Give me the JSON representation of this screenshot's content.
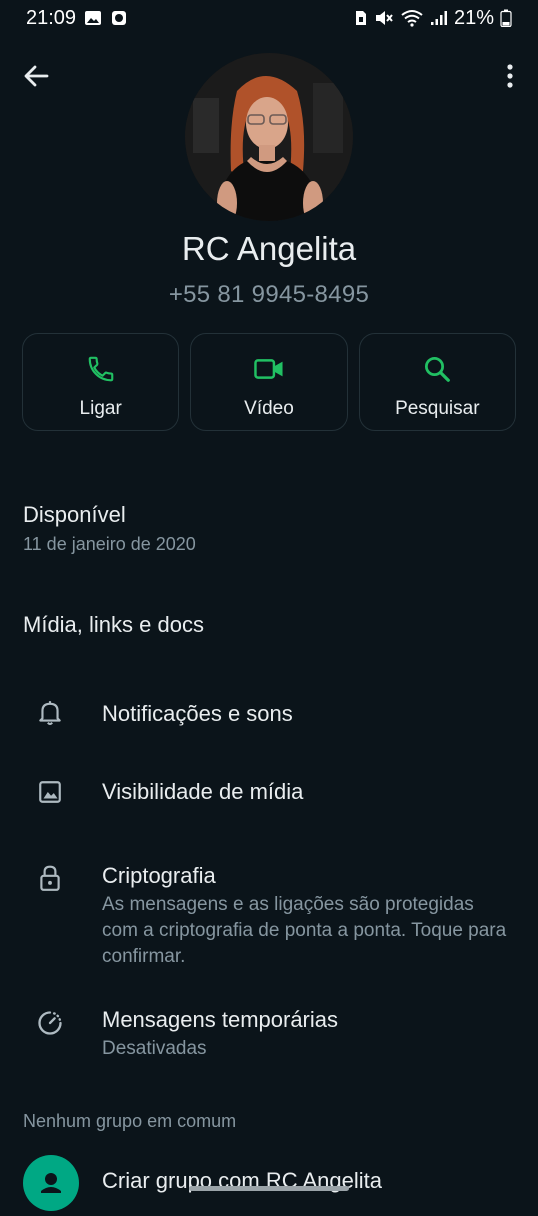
{
  "status_bar": {
    "time": "21:09",
    "battery": "21%"
  },
  "contact": {
    "name": "RC Angelita",
    "phone": "+55 81 9945-8495"
  },
  "actions": [
    {
      "label": "Ligar",
      "icon": "phone-icon"
    },
    {
      "label": "Vídeo",
      "icon": "video-icon"
    },
    {
      "label": "Pesquisar",
      "icon": "search-icon"
    }
  ],
  "about": {
    "status": "Disponível",
    "date": "11 de janeiro de 2020"
  },
  "media": {
    "label": "Mídia, links e docs"
  },
  "settings": [
    {
      "title": "Notificações e sons",
      "icon": "bell-icon"
    },
    {
      "title": "Visibilidade de mídia",
      "icon": "image-icon"
    },
    {
      "title": "Criptografia",
      "subtitle": "As mensagens e as ligações são protegidas com a criptografia de ponta a ponta. Toque para confirmar.",
      "icon": "lock-icon"
    },
    {
      "title": "Mensagens temporárias",
      "subtitle": "Desativadas",
      "icon": "timer-icon"
    }
  ],
  "groups": {
    "header": "Nenhum grupo em comum",
    "create_label": "Criar grupo com RC Angelita"
  },
  "colors": {
    "background": "#0b141a",
    "accent": "#00a884",
    "icon_green": "#21c063",
    "secondary_text": "#8696a0"
  }
}
